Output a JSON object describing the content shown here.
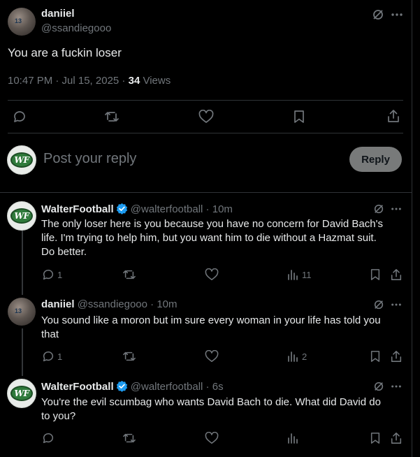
{
  "main_tweet": {
    "author_name": "daniiel",
    "author_handle": "@ssandiegooo",
    "text": "You are a fuckin loser",
    "time": "10:47 PM · Jul 15, 2025 · ",
    "views_count": "34",
    "views_label": " Views"
  },
  "reply_box": {
    "placeholder": "Post your reply",
    "button_label": "Reply",
    "avatar_text": "WF"
  },
  "replies": [
    {
      "name": "WalterFootball",
      "handle": "@walterfootball",
      "age": " · 10m",
      "text": "The only loser here is you because you have no concern for David Bach's life. I'm trying to help him, but you want him to die without a Hazmat suit. Do better.",
      "replies_count": "1",
      "views_count": "11",
      "avatar_text": "WF"
    },
    {
      "name": "daniiel",
      "handle": "@ssandiegooo",
      "age": " · 10m",
      "text": "You sound like a moron but im sure every woman in your life has told you that",
      "replies_count": "1",
      "views_count": "2",
      "avatar_text": "13"
    },
    {
      "name": "WalterFootball",
      "handle": "@walterfootball",
      "age": " · 6s",
      "text": "You're the evil scumbag who wants David Bach to die. What did David do to you?",
      "avatar_text": "WF"
    }
  ],
  "main_avatar_text": "13",
  "colors": {
    "background": "#000000",
    "text": "#e7e9ea",
    "muted": "#71767b",
    "verified": "#1d9bf0",
    "divider": "#2f3336"
  }
}
